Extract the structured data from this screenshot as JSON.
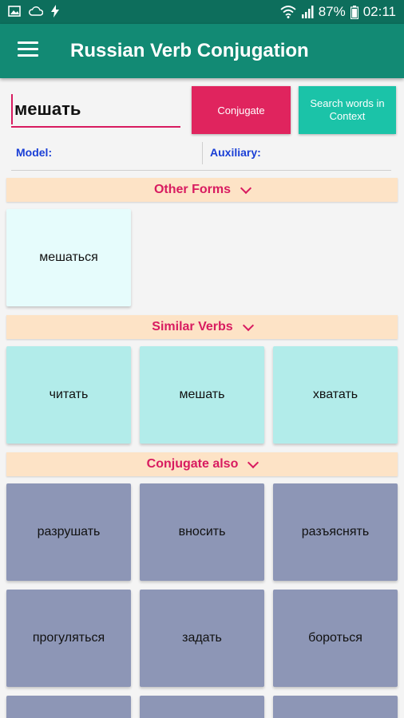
{
  "status_bar": {
    "battery": "87%",
    "time": "02:11"
  },
  "app_bar": {
    "title": "Russian Verb Conjugation"
  },
  "search": {
    "value": "мешать"
  },
  "buttons": {
    "conjugate": "Conjugate",
    "search_context": "Search words in Context"
  },
  "fields": {
    "model_label": "Model:",
    "auxiliary_label": "Auxiliary:"
  },
  "other_forms": {
    "title": "Other Forms",
    "items": [
      "мешаться"
    ]
  },
  "similar_verbs": {
    "title": "Similar Verbs",
    "items": [
      "читать",
      "мешать",
      "хватать"
    ]
  },
  "conjugate_also": {
    "title": "Conjugate also",
    "items": [
      "разрушать",
      "вносить",
      "разъяснять",
      "прогуляться",
      "задать",
      "бороться"
    ]
  },
  "colors": {
    "primary": "#128a74",
    "accent": "#e0245e",
    "context_button": "#1bc3a8",
    "section_bg": "#fde3c6",
    "section_text": "#d81b60"
  }
}
